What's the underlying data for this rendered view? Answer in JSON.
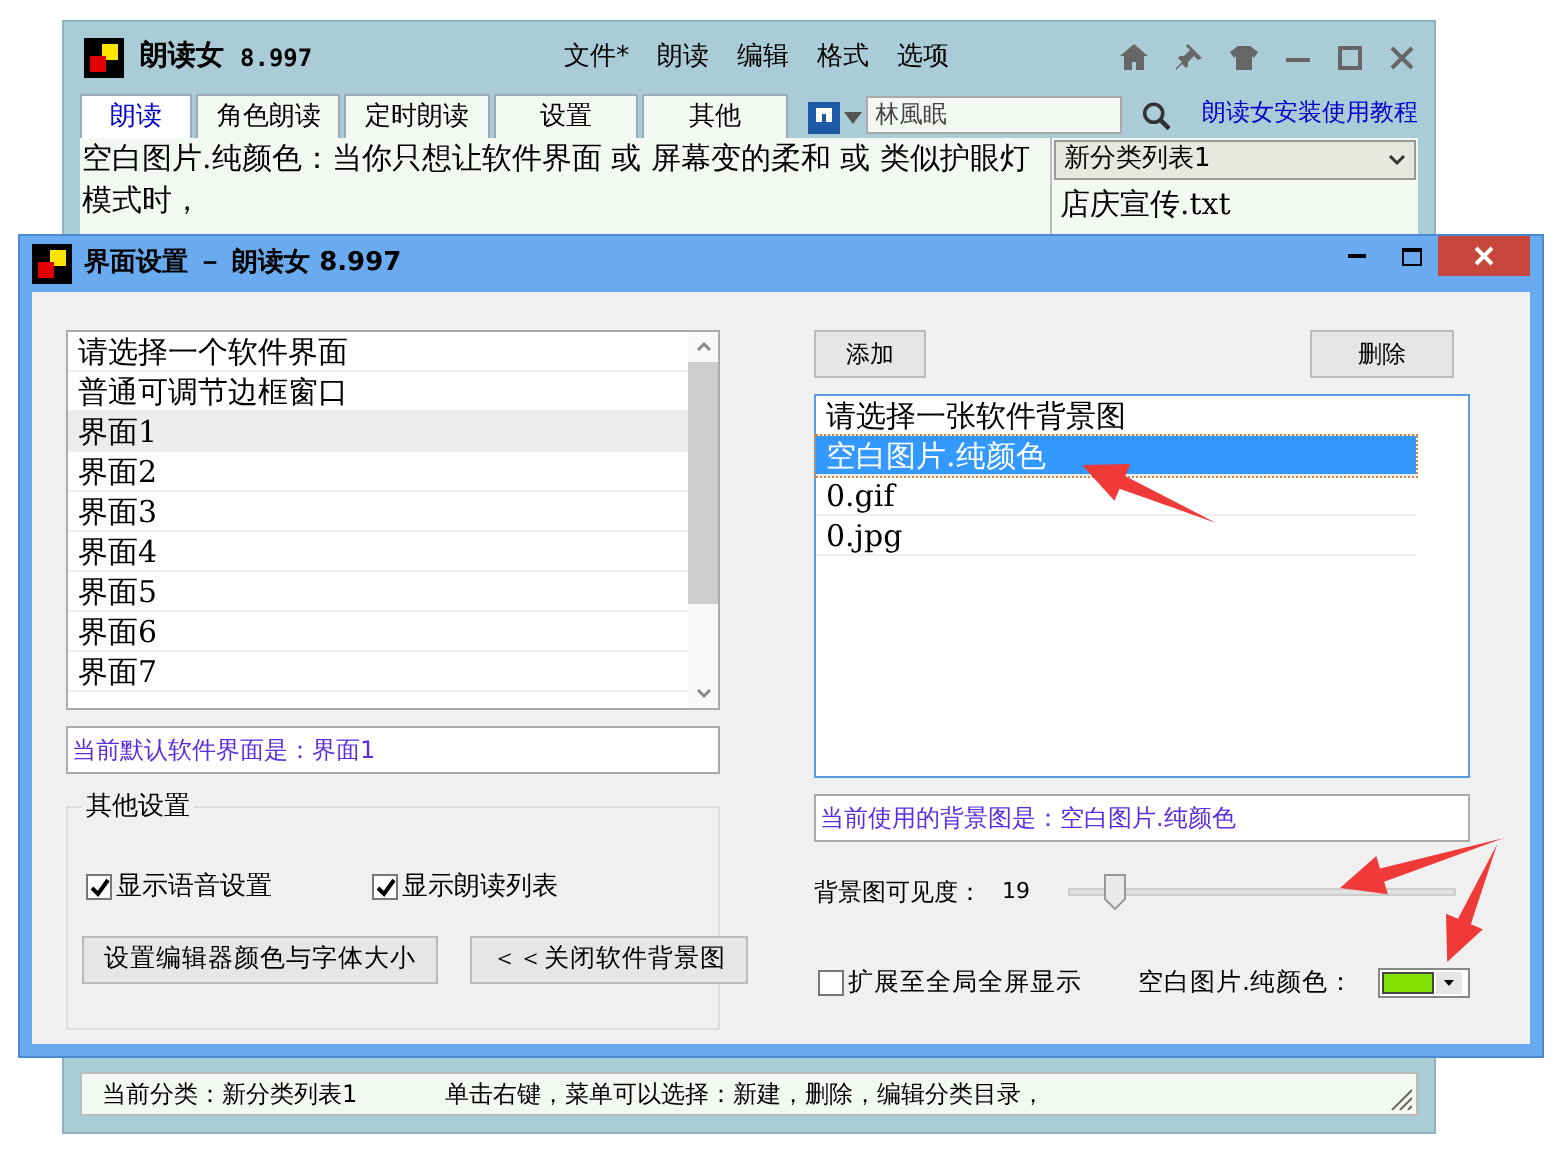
{
  "main_window": {
    "title": "朗读女",
    "version": "8.997",
    "menu": [
      "文件*",
      "朗读",
      "编辑",
      "格式",
      "选项"
    ],
    "tabs": [
      {
        "label": "朗读",
        "selected": true
      },
      {
        "label": "角色朗读",
        "selected": false
      },
      {
        "label": "定时朗读",
        "selected": false
      },
      {
        "label": "设置",
        "selected": false
      },
      {
        "label": "其他",
        "selected": false
      }
    ],
    "search": {
      "value": "林風眠"
    },
    "help_link": "朗读女安装使用教程",
    "editor_text": "空白图片.纯颜色：当你只想让软件界面 或 屏幕变的柔和 或 类似护眼灯模式时，",
    "category_select": "新分类列表1",
    "file_list": [
      "店庆宣传.txt"
    ],
    "status_bar": {
      "category": "当前分类：新分类列表1",
      "hint": "单击右键，菜单可以选择：新建，删除，编辑分类目录，"
    }
  },
  "dialog": {
    "title": "界面设置 － 朗读女 8.997",
    "skin_list": [
      {
        "label": "请选择一个软件界面",
        "selected": false
      },
      {
        "label": "普通可调节边框窗口",
        "selected": false
      },
      {
        "label": "界面1",
        "selected": true
      },
      {
        "label": "界面2",
        "selected": false
      },
      {
        "label": "界面3",
        "selected": false
      },
      {
        "label": "界面4",
        "selected": false
      },
      {
        "label": "界面5",
        "selected": false
      },
      {
        "label": "界面6",
        "selected": false
      },
      {
        "label": "界面7",
        "selected": false
      }
    ],
    "current_skin": "当前默认软件界面是：界面1",
    "other_settings": {
      "title": "其他设置",
      "checkboxes": [
        {
          "label": "显示语音设置",
          "checked": true
        },
        {
          "label": "显示朗读列表",
          "checked": true
        }
      ],
      "buttons": [
        "设置编辑器颜色与字体大小",
        "＜＜关闭软件背景图"
      ]
    },
    "add_button": "添加",
    "delete_button": "删除",
    "background_list": [
      {
        "label": "请选择一张软件背景图",
        "selected": false
      },
      {
        "label": "空白图片.纯颜色",
        "selected": true
      },
      {
        "label": "0.gif",
        "selected": false
      },
      {
        "label": "0.jpg",
        "selected": false
      }
    ],
    "current_background": "当前使用的背景图是：空白图片.纯颜色",
    "visibility": {
      "label": "背景图可见度：",
      "reading": "19",
      "level": 0.12
    },
    "fullscreen": {
      "label": "扩展至全局全屏显示",
      "checked": false
    },
    "color_picker": {
      "label": "空白图片.纯颜色：",
      "color": "#80e000"
    }
  }
}
